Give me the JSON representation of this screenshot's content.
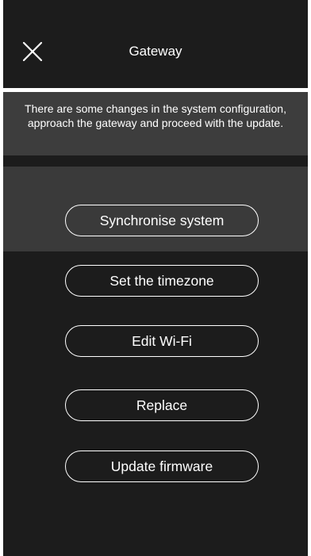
{
  "header": {
    "title": "Gateway",
    "close_icon": "close-icon"
  },
  "notice": {
    "text": "There are some changes in the system configuration, approach the gateway and proceed with the update."
  },
  "actions": {
    "synchronise": "Synchronise system",
    "timezone": "Set the timezone",
    "wifi": "Edit Wi-Fi",
    "replace": "Replace",
    "firmware": "Update firmware"
  },
  "colors": {
    "background": "#1c1c1c",
    "notice_background": "#3d3d3d",
    "highlight_band": "#3a3a3a",
    "foreground": "#ffffff"
  }
}
